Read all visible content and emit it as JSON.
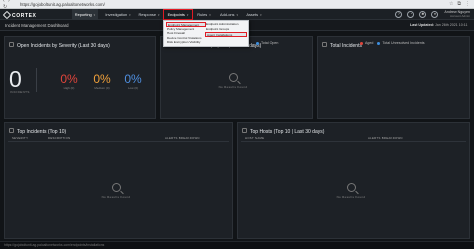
{
  "browser": {
    "nav_icons": [
      "arrow-left-icon",
      "arrow-right-icon",
      "reload-icon"
    ],
    "url": "https://gojoboltunit.ag.paloaltonetworks.com/",
    "tool_icons": [
      "star-icon",
      "extension-icon",
      "menu-icon"
    ]
  },
  "topnav": {
    "logo_text": "CORTEX",
    "logo_sub": "XDR",
    "items": [
      {
        "label": "Reporting",
        "active": true
      },
      {
        "label": "Investigation"
      },
      {
        "label": "Response"
      },
      {
        "label": "Endpoints",
        "open": true
      },
      {
        "label": "Rules"
      },
      {
        "label": "Add-ons"
      },
      {
        "label": "Assets"
      }
    ],
    "icons": [
      "help-icon",
      "notifications-icon",
      "settings-icon",
      "user-avatar-icon"
    ],
    "user_name": "Andrew Nguyen",
    "user_role": "Account Admin"
  },
  "endpoints_menu": {
    "col1": [
      "Endpoint Management",
      "Policy Management",
      "Host Firewall",
      "Device Control Violations",
      "Disk Encryption Visibility"
    ],
    "col2": [
      "Endpoint Administration",
      "Endpoint Groups",
      "Agent Installations"
    ],
    "highlighted": [
      "Endpoint Management",
      "Agent Installations"
    ]
  },
  "dashboard": {
    "name": "Incident Management Dashboard",
    "last_updated_label": "Last Updated:",
    "last_updated_value": "Jan 26th 2021 10:11"
  },
  "severity_panel": {
    "title": "Open Incidents by Severity (Last 30 days)",
    "total": "0",
    "total_label": "INCIDENTS",
    "metrics": [
      {
        "value": "0%",
        "label": "High (0)",
        "color": "#e0453b"
      },
      {
        "value": "0%",
        "label": "Medium (0)",
        "color": "#f0a03a"
      },
      {
        "value": "0%",
        "label": "Low (0)",
        "color": "#4f8fe0"
      }
    ]
  },
  "assignee_panel": {
    "title": "... (Top 10 | Last 30 days)",
    "legend": [
      "Total Open"
    ],
    "legend_color": "#3d8fe0",
    "no_results": "No Results Found"
  },
  "total_panel": {
    "title": "Total Incidents",
    "legend": [
      "Aged",
      "Total Unresolved Incidents"
    ],
    "legend_colors": [
      "#e0453b",
      "#3d8fe0"
    ]
  },
  "top_incidents": {
    "title": "Top Incidents (Top 10)",
    "columns": [
      "SEVERITY",
      "DESCRIPTION",
      "ALERTS BREAKDOWN"
    ],
    "no_results": "No Results Found"
  },
  "top_hosts": {
    "title": "Top Hosts (Top 10 | Last 30 days)",
    "columns": [
      "HOST NAME",
      "ALERTS BREAKDOWN"
    ],
    "no_results": "No Results Found"
  },
  "statusbar": {
    "text": "https://gojoboltunit.ag.paloaltonetworks.com/endpoints/installations"
  }
}
